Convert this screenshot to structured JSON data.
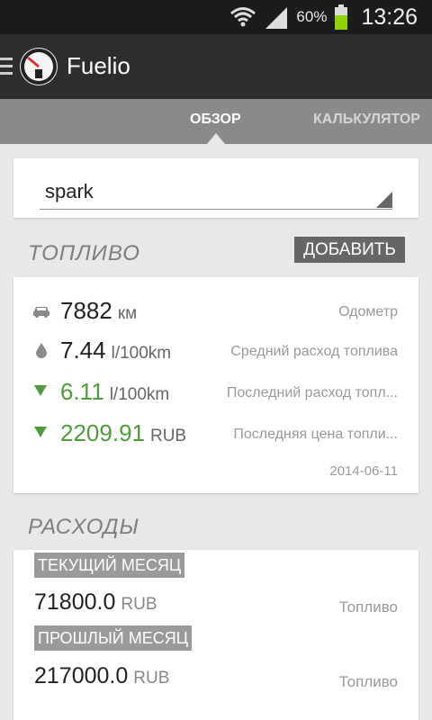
{
  "status_bar": {
    "battery_text": "60%",
    "time": "13:26"
  },
  "app": {
    "title": "Fuelio"
  },
  "tabs": [
    {
      "label": "ОБЗОР",
      "active": true
    },
    {
      "label": "КАЛЬКУЛЯТОР",
      "active": false
    }
  ],
  "vehicle_selector": {
    "value": "spark"
  },
  "fuel_section": {
    "title": "ТОПЛИВО",
    "add_label": "ДОБАВИТЬ",
    "rows": [
      {
        "icon": "car-icon",
        "value": "7882",
        "unit": "км",
        "label": "Одометр"
      },
      {
        "icon": "fuel-drop-icon",
        "value": "7.44",
        "unit": "l/100km",
        "label": "Средний расход топлива"
      },
      {
        "icon": "arrow-down-icon",
        "value": "6.11",
        "unit": "l/100km",
        "label": "Последний расход топл..."
      },
      {
        "icon": "arrow-down-icon",
        "value": "2209.91",
        "unit": "RUB",
        "label": "Последняя цена топли..."
      }
    ],
    "date": "2014-06-11"
  },
  "expenses_section": {
    "title": "РАСХОДЫ",
    "current_month": {
      "label": "ТЕКУЩИЙ МЕСЯЦ",
      "value": "71800.0",
      "unit": "RUB",
      "category": "Топливо"
    },
    "last_month": {
      "label": "ПРОШЛЫЙ МЕСЯЦ",
      "value": "217000.0",
      "unit": "RUB",
      "category": "Топливо"
    }
  },
  "colors": {
    "accent_green": "#4f9b3d",
    "action_bar": "#2e2e2e",
    "tab_bar": "#8a8a8a"
  }
}
